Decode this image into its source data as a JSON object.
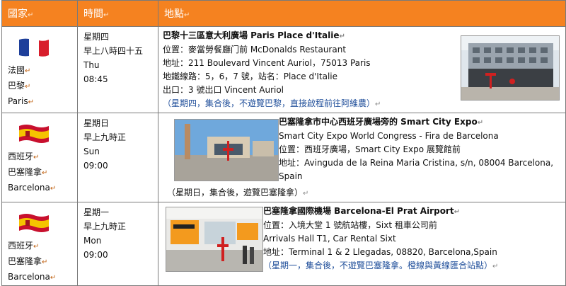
{
  "header": {
    "country": "國家",
    "time": "時間",
    "location": "地點"
  },
  "rows": [
    {
      "country": [
        "法國",
        "巴黎",
        "Paris"
      ],
      "flag": "france",
      "time": [
        "星期四",
        "早上八時四十五",
        "Thu",
        "08:45"
      ],
      "title": "巴黎十三區意大利廣場  Paris Place d'Italie",
      "lines": [
        "位置：麥當勞餐廳门前 McDonalds Restaurant",
        "地址：211 Boulevard Vincent Auriol，75013 Paris",
        "地鐵線路：5，6，7 號，站名：Place d'Italie",
        "出口：3 號出口  Vincent Auriol"
      ],
      "note": "（星期四，集合後，不遊覽巴黎，直接啟程前往阿維農）"
    },
    {
      "country": [
        "西班牙",
        "巴塞隆拿",
        "Barcelona"
      ],
      "flag": "spain",
      "time": [
        "星期日",
        "早上九時正",
        "Sun",
        "09:00"
      ],
      "title": "巴塞隆拿市中心西班牙廣場旁的 Smart City Expo",
      "lines": [
        "Smart City Expo World Congress - Fira de Barcelona",
        "位置：西班牙廣場，Smart City Expo  展覽館前",
        "地址：Avinguda de la Reina Maria Cristina, s/n, 08004 Barcelona,",
        "Spain"
      ],
      "note": "（星期日，集合後，遊覽巴塞隆拿）"
    },
    {
      "country": [
        "西班牙",
        "巴塞隆拿",
        "Barcelona"
      ],
      "flag": "spain",
      "time": [
        "星期一",
        "早上九時正",
        "Mon",
        "09:00"
      ],
      "title": "巴塞隆拿國際機場 Barcelona-El Prat Airport",
      "lines": [
        "位置：入境大堂 1 號航站樓，Sixt  租車公司前",
        "Arrivals Hall T1, Car Rental Sixt",
        "地址：Terminal 1 & 2 Llegadas, 08820, Barcelona,Spain"
      ],
      "note": "（星期一，集合後，不遊覽巴塞隆拿。橙線與黃線匯合站點）"
    }
  ],
  "colors": {
    "header_bg": "#f58220",
    "note_text": "#1f4e9a"
  }
}
